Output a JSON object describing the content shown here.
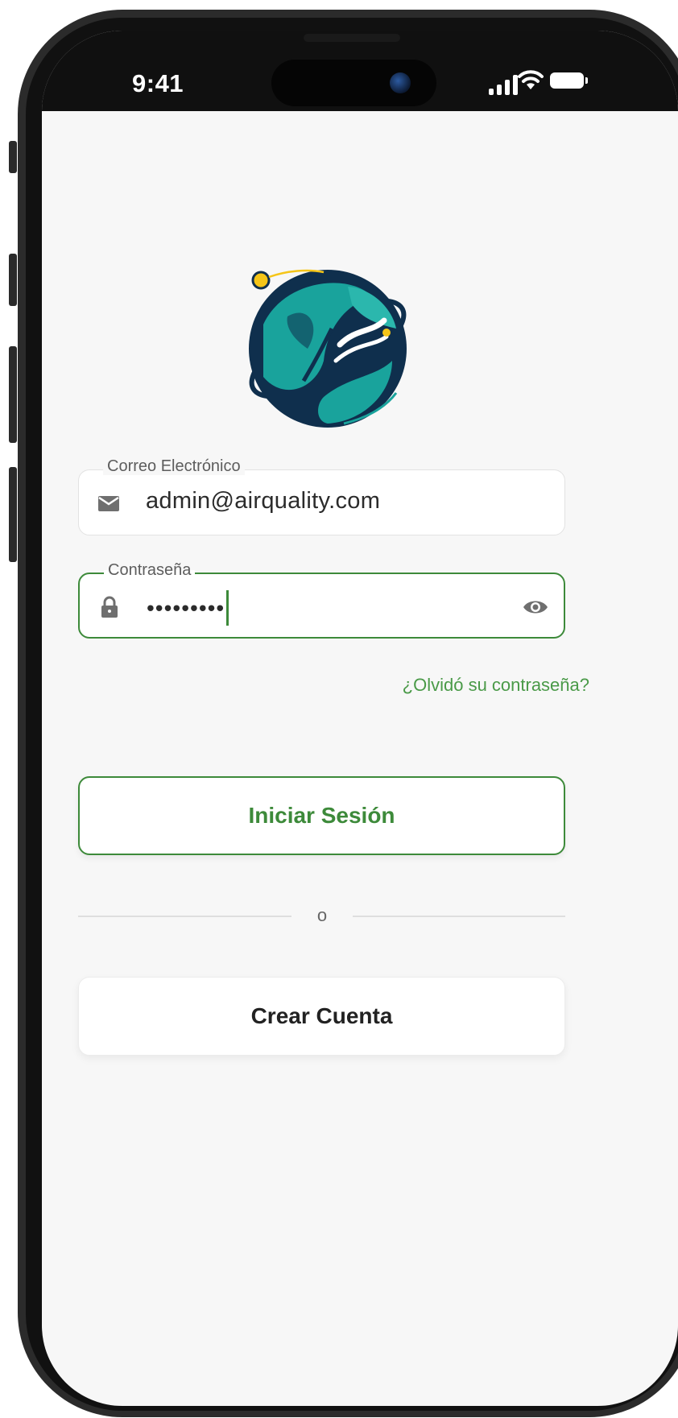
{
  "status_bar": {
    "time": "9:41"
  },
  "login": {
    "email_field": {
      "label": "Correo Electrónico",
      "value": "admin@airquality.com",
      "icon": "mail-icon"
    },
    "password_field": {
      "label": "Contraseña",
      "value": "•••••••••",
      "icon": "lock-icon",
      "toggle_icon": "eye-icon"
    },
    "forgot_link": "¿Olvidó su contraseña?",
    "login_button": "Iniciar Sesión",
    "divider_text": "o",
    "create_account_button": "Crear Cuenta"
  },
  "colors": {
    "accent": "#3d8a3a",
    "logo_navy": "#0f2f4d",
    "logo_teal": "#19a39c",
    "logo_yellow": "#f5c518",
    "screen_bg": "#f7f7f7"
  }
}
